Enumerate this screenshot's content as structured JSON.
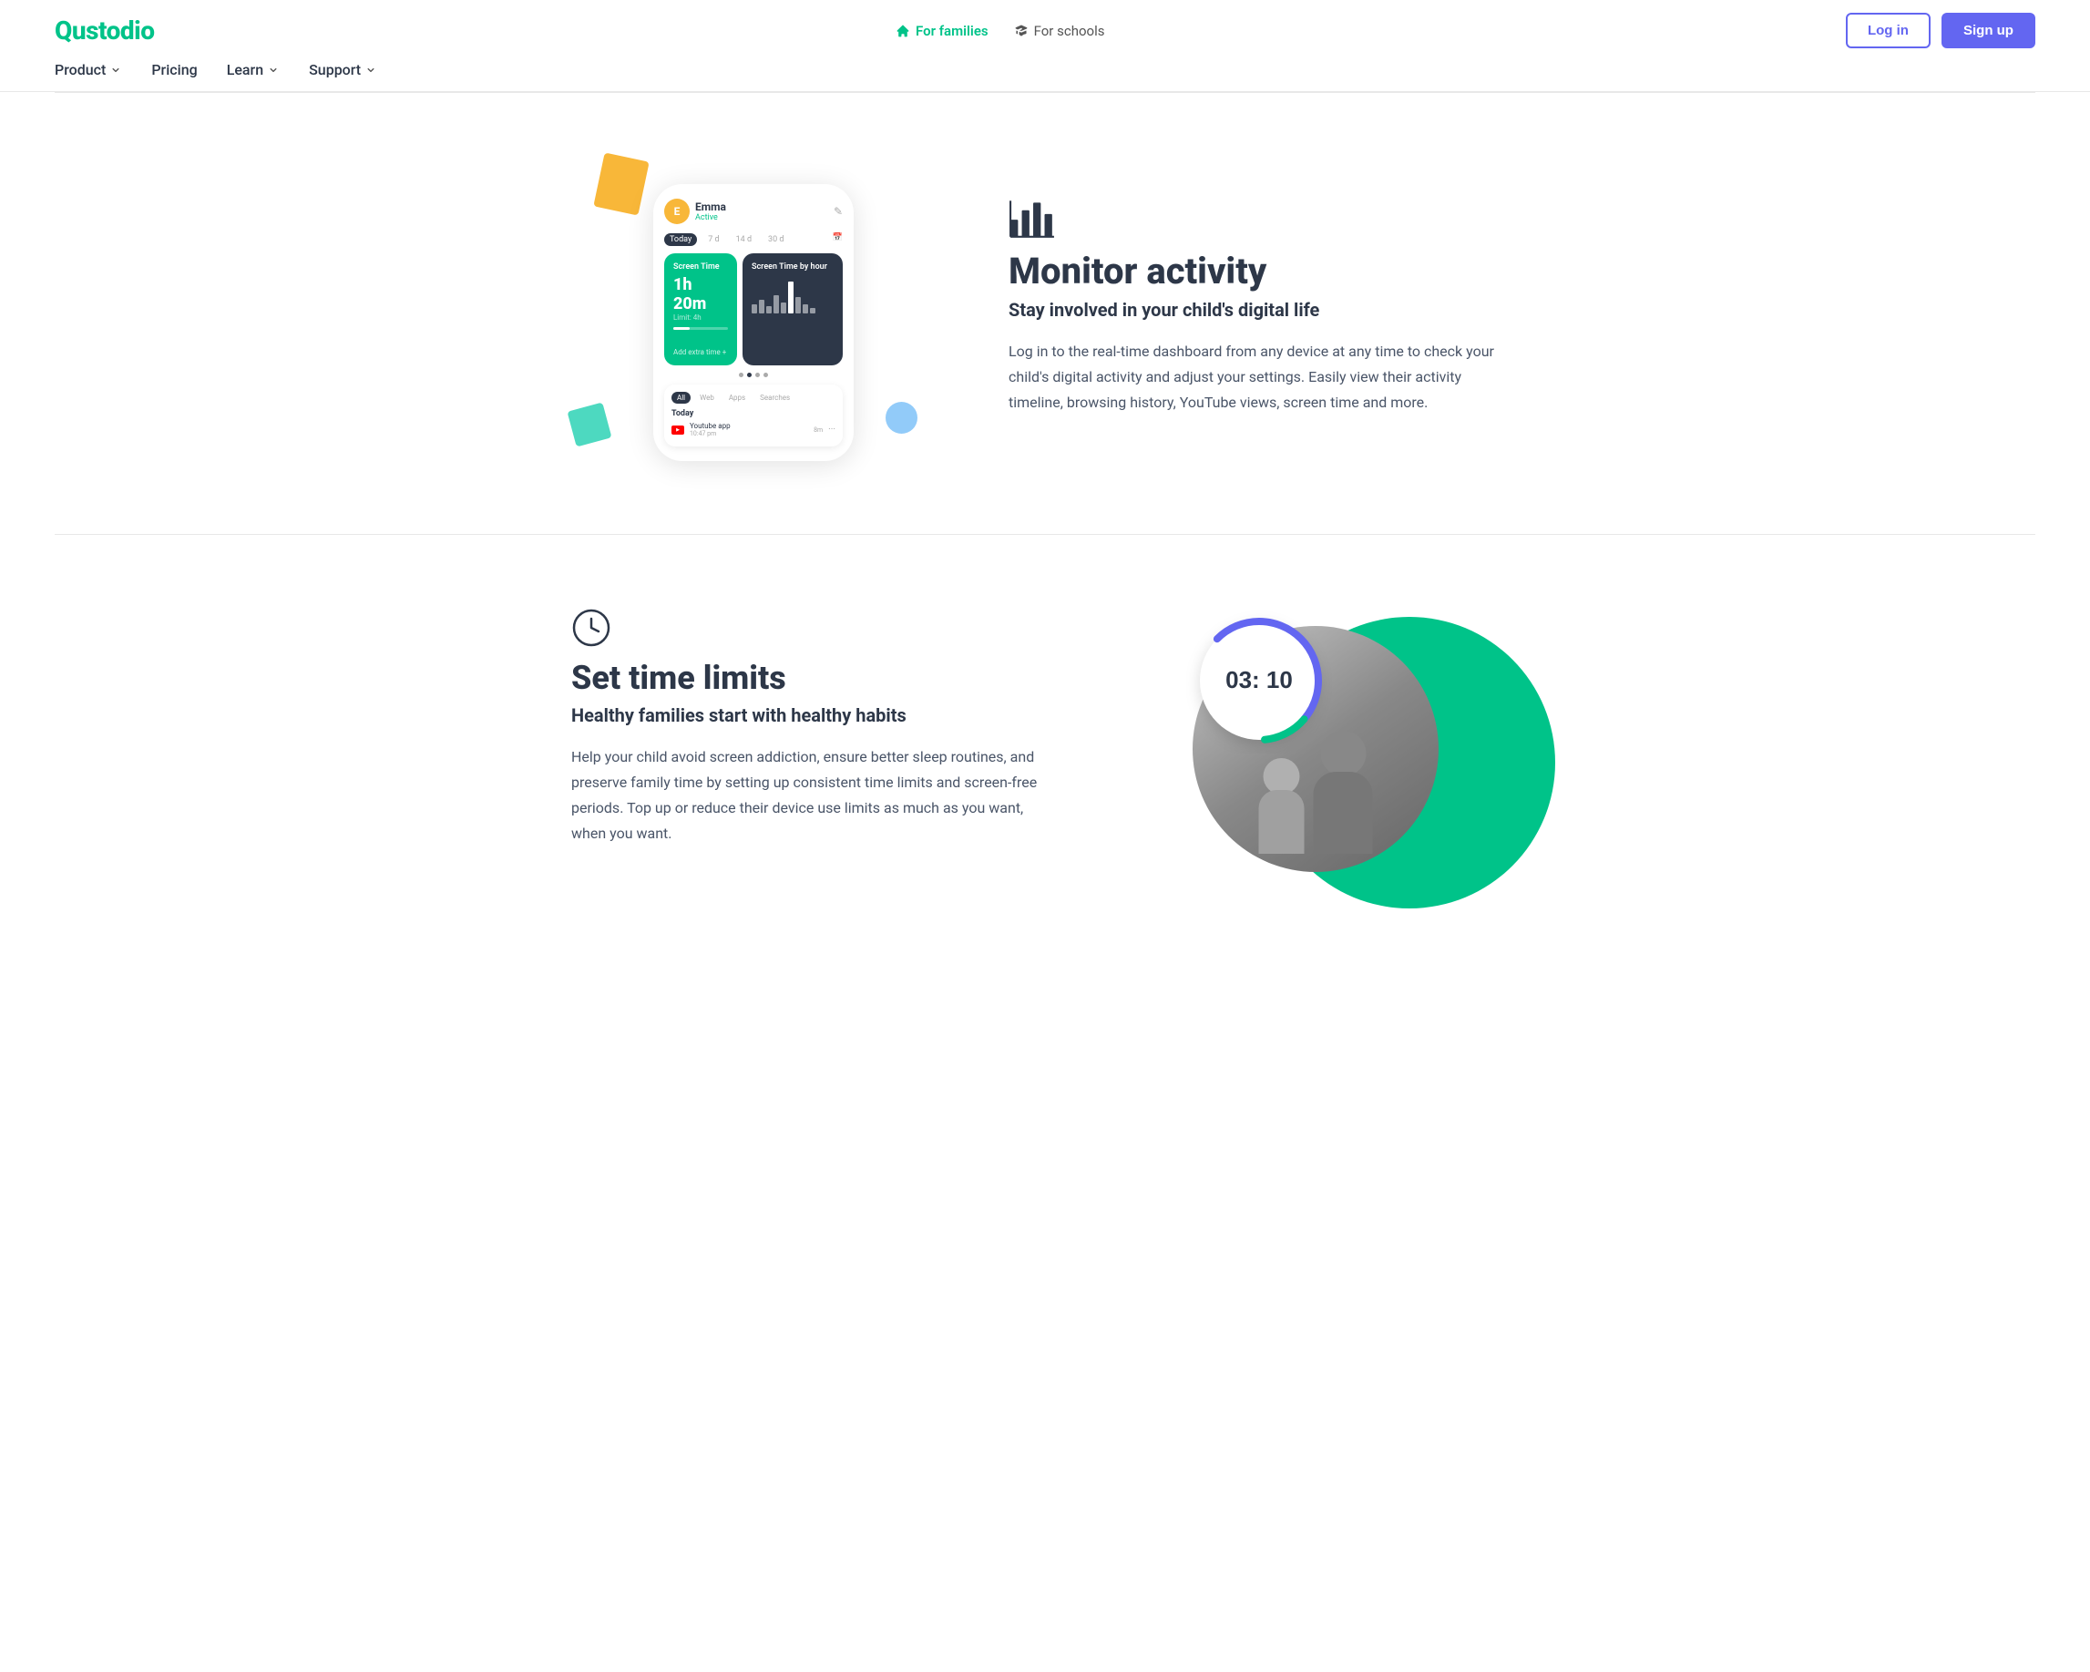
{
  "brand": {
    "name": "Qustodio",
    "color": "#00c389"
  },
  "header": {
    "top_nav": [
      {
        "label": "For families",
        "active": true,
        "icon": "home-icon"
      },
      {
        "label": "For schools",
        "active": false,
        "icon": "school-icon"
      }
    ],
    "main_nav": [
      {
        "label": "Product",
        "has_dropdown": true
      },
      {
        "label": "Pricing",
        "has_dropdown": false
      },
      {
        "label": "Learn",
        "has_dropdown": true
      },
      {
        "label": "Support",
        "has_dropdown": true
      }
    ],
    "login_label": "Log in",
    "signup_label": "Sign up"
  },
  "section_monitor": {
    "icon_label": "chart-bar-icon",
    "title": "Monitor activity",
    "subtitle": "Stay involved in your child's digital life",
    "description": "Log in to the real-time dashboard from any device at any time to check your child's digital activity and adjust your settings. Easily view their activity timeline, browsing history, YouTube views, screen time and more.",
    "phone": {
      "child_name": "Emma",
      "child_status": "Active",
      "date_tabs": [
        "Today",
        "7 d",
        "14 d",
        "30 d"
      ],
      "panel_left_title": "Screen Time",
      "panel_left_time": "1h 20m",
      "panel_left_limit": "Limit: 4h",
      "panel_left_add": "Add extra time +",
      "panel_right_title": "Screen Time by hour",
      "filter_tabs": [
        "All",
        "Web",
        "Apps",
        "Searches"
      ],
      "today_label": "Today",
      "activity_time": "10:47 pm",
      "activity_label": "Youtube app",
      "activity_duration": "8m"
    }
  },
  "section_timelimits": {
    "icon_label": "clock-icon",
    "title": "Set time limits",
    "subtitle": "Healthy families start with healthy habits",
    "description": "Help your child avoid screen addiction, ensure better sleep routines, and preserve family time by setting up consistent time limits and screen-free periods. Top up or reduce their device use limits as much as you want, when you want.",
    "timer_display": "03: 10",
    "arc_color_1": "#6366f1",
    "arc_color_2": "#00c389"
  }
}
